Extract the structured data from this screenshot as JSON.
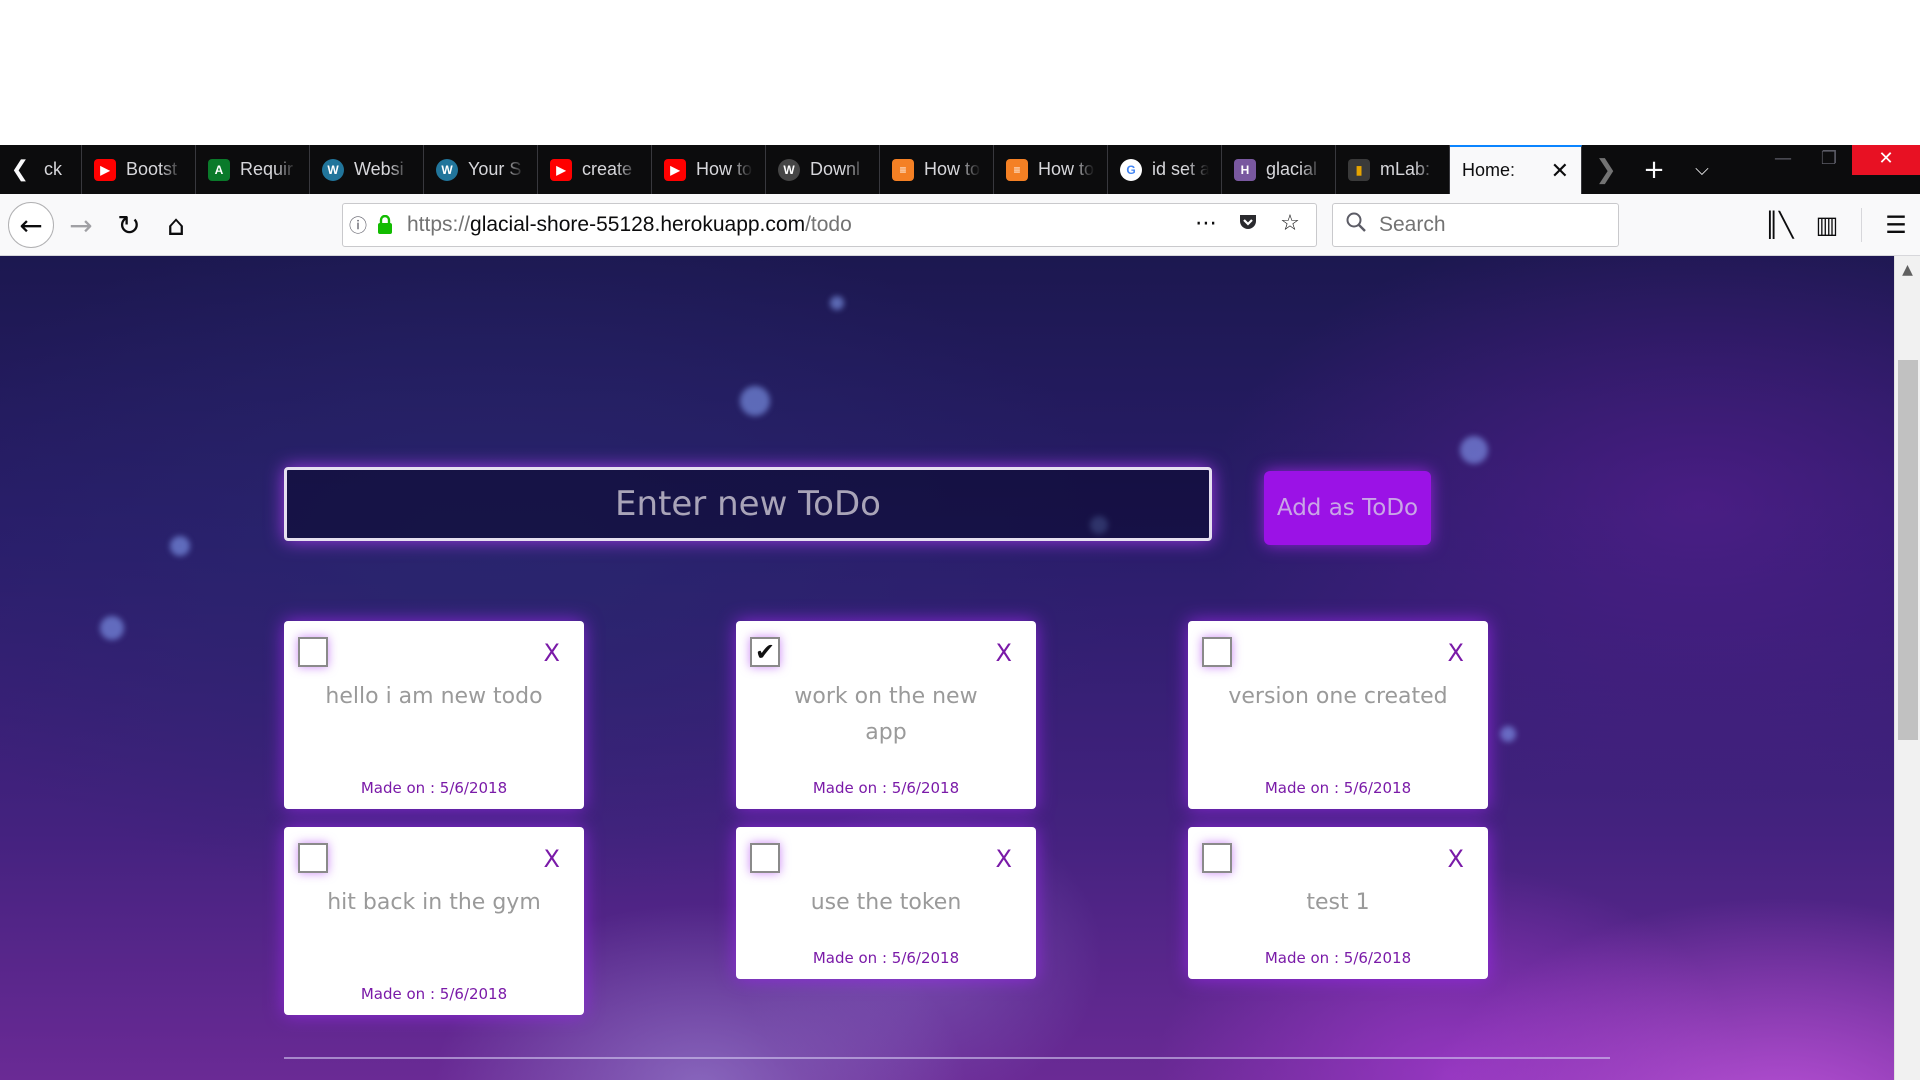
{
  "browser": {
    "tabs": [
      {
        "label": "ck",
        "icon": "youtube-icon",
        "color": "#0c0c0d"
      },
      {
        "label": "Bootst",
        "icon": "youtube-icon",
        "color": "#ff0000"
      },
      {
        "label": "Requir",
        "icon": "android-icon",
        "color": "#0a7a2a"
      },
      {
        "label": "Websi",
        "icon": "wordpress-icon",
        "color": "#21759b"
      },
      {
        "label": "Your S",
        "icon": "wordpress-icon",
        "color": "#21759b"
      },
      {
        "label": "create",
        "icon": "youtube-icon",
        "color": "#ff0000"
      },
      {
        "label": "How to",
        "icon": "youtube-icon",
        "color": "#ff0000"
      },
      {
        "label": "Downl",
        "icon": "wordpress-icon",
        "color": "#464646"
      },
      {
        "label": "How to",
        "icon": "stackoverflow-icon",
        "color": "#f48024"
      },
      {
        "label": "How to",
        "icon": "stackoverflow-icon",
        "color": "#f48024"
      },
      {
        "label": "id set a",
        "icon": "google-icon",
        "color": "#4285f4"
      },
      {
        "label": "glacial",
        "icon": "heroku-icon",
        "color": "#79589f"
      },
      {
        "label": "mLab:",
        "icon": "mlab-icon",
        "color": "#e6a400"
      }
    ],
    "active_tab": {
      "label": "Home:"
    },
    "url": {
      "prefix": "https://",
      "host": "glacial-shore-55128.herokuapp.com",
      "path": "/todo"
    },
    "search": {
      "placeholder": "Search"
    }
  },
  "app": {
    "input_placeholder": "Enter new ToDo",
    "add_button": "Add as ToDo",
    "delete_label": "X",
    "todos": [
      {
        "text": "hello i am new todo",
        "made": "Made on : 5/6/2018",
        "done": false
      },
      {
        "text": "work on the new app",
        "made": "Made on : 5/6/2018",
        "done": true
      },
      {
        "text": "version one created",
        "made": "Made on : 5/6/2018",
        "done": false
      },
      {
        "text": "hit back in the gym",
        "made": "Made on : 5/6/2018",
        "done": false
      },
      {
        "text": "use the token",
        "made": "Made on : 5/6/2018",
        "done": false
      },
      {
        "text": "test 1",
        "made": "Made on : 5/6/2018",
        "done": false
      }
    ]
  },
  "colors": {
    "accent": "#9b12e6",
    "delete": "#7a1aa8",
    "active_tab_indicator": "#0a84ff"
  }
}
